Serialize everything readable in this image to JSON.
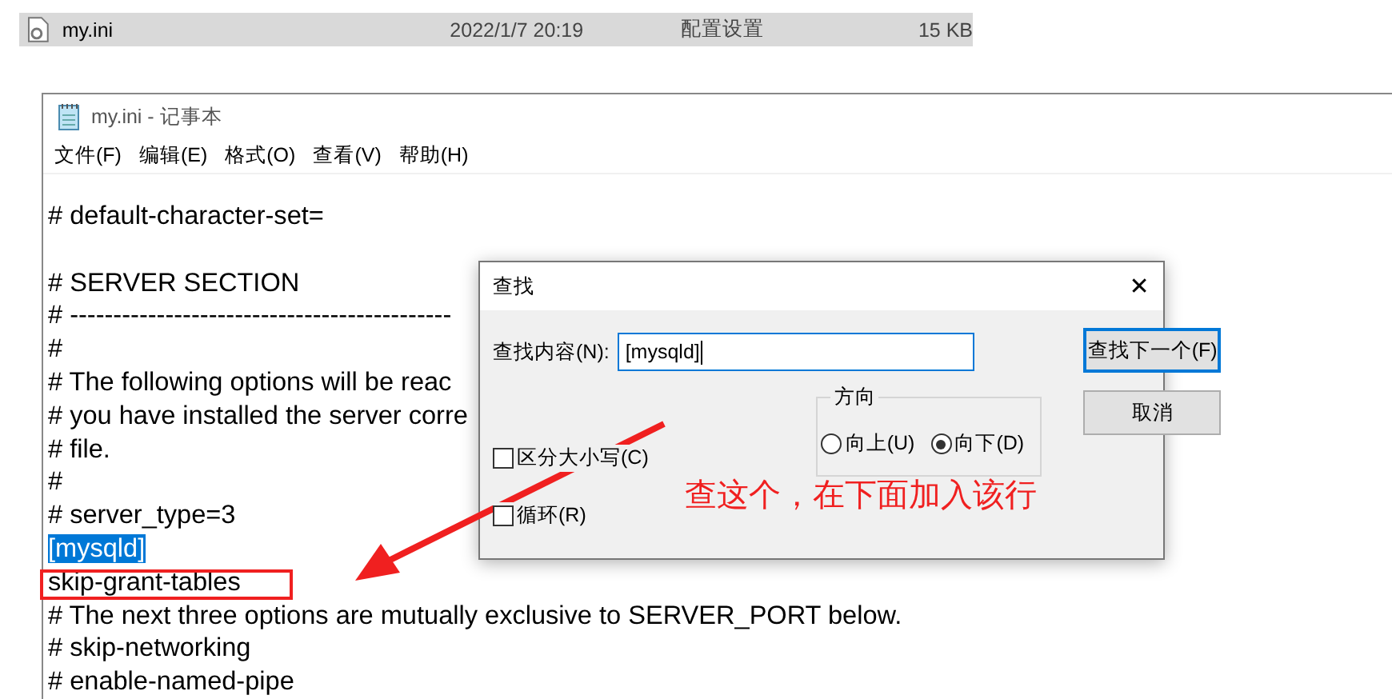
{
  "explorer_row": {
    "name": "my.ini",
    "date": "2022/1/7 20:19",
    "type": "配置设置",
    "size": "15 KB",
    "selected": true
  },
  "notepad": {
    "title": "my.ini - 记事本",
    "menu": [
      "文件(F)",
      "编辑(E)",
      "格式(O)",
      "查看(V)",
      "帮助(H)"
    ],
    "lines": [
      {
        "kind": "text",
        "text": "# default-character-set=",
        "selected": false
      },
      {
        "kind": "blank",
        "selected": false
      },
      {
        "kind": "text",
        "text": "# SERVER SECTION",
        "selected": false
      },
      {
        "kind": "text",
        "text": "# --------------------------------------------",
        "selected": false
      },
      {
        "kind": "text",
        "text": "#",
        "selected": false
      },
      {
        "kind": "text",
        "text": "# The following options will be reac",
        "selected": false
      },
      {
        "kind": "text",
        "text": "# you have installed the server corre",
        "selected": false
      },
      {
        "kind": "text",
        "text": "# file.",
        "selected": false
      },
      {
        "kind": "text",
        "text": "#",
        "selected": false
      },
      {
        "kind": "text",
        "text": "# server_type=3",
        "selected": false
      },
      {
        "kind": "text",
        "text": "[mysqld]",
        "selected": true
      },
      {
        "kind": "text",
        "text": "skip-grant-tables",
        "selected": false,
        "highlighted": true
      },
      {
        "kind": "text",
        "text": "# The next three options are mutually exclusive to SERVER_PORT below.",
        "selected": false
      },
      {
        "kind": "text",
        "text": "# skip-networking",
        "selected": false
      },
      {
        "kind": "text",
        "text": "# enable-named-pipe",
        "selected": false
      }
    ]
  },
  "find_dialog": {
    "title": "查找",
    "close": "✕",
    "label": "查找内容(N):",
    "value": "[mysqld]",
    "buttons": [
      {
        "label": "查找下一个(F)",
        "focused": true
      },
      {
        "label": "取消",
        "focused": false
      }
    ],
    "checkboxes": [
      {
        "label": "区分大小写(C)",
        "checked": false
      },
      {
        "label": "循环(R)",
        "checked": false
      }
    ],
    "direction": {
      "title": "方向",
      "options": [
        {
          "label": "向上(U)",
          "selected": false
        },
        {
          "label": "向下(D)",
          "selected": true
        }
      ]
    }
  },
  "annotation": {
    "text": "查这个，在下面加入该行"
  }
}
